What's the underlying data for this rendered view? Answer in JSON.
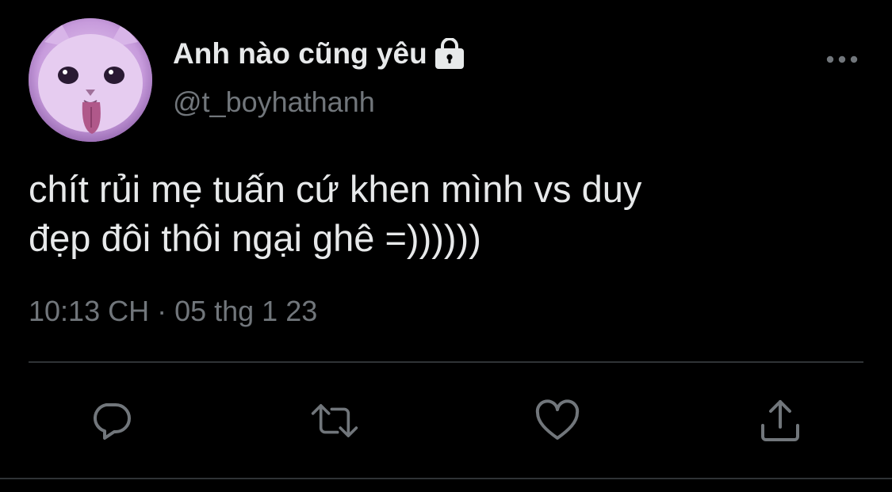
{
  "user": {
    "display_name": "Anh nào cũng yêu",
    "handle": "@t_boyhathanh",
    "protected_icon": "lock-icon",
    "avatar": "cat-avatar"
  },
  "tweet": {
    "lines": [
      "chít rủi mẹ tuấn cứ khen mình vs duy",
      "đẹp đôi thôi ngại ghê =))))))"
    ],
    "time": "10:13 CH",
    "separator": "·",
    "date": "05 thg 1 23"
  },
  "actions": {
    "icons": [
      "reply-icon",
      "retweet-icon",
      "like-icon",
      "share-icon"
    ]
  },
  "more_icon": "more-horizontal-icon",
  "colors": {
    "background": "#000000",
    "text_primary": "#e7e9ea",
    "text_secondary": "#71767b",
    "divider": "#2f3336"
  }
}
